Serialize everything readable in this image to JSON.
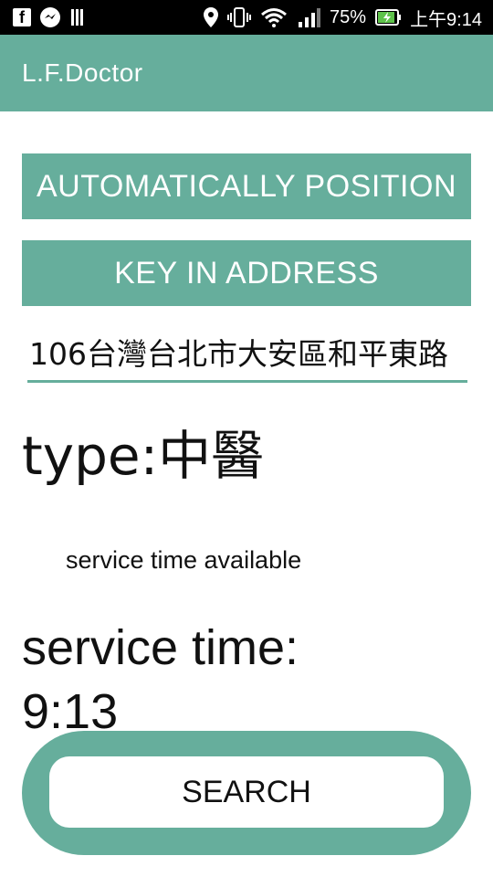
{
  "status_bar": {
    "battery": "75%",
    "time": "上午9:14",
    "icons": [
      "facebook-icon",
      "messenger-icon",
      "barcode-icon",
      "location-icon",
      "vibrate-icon",
      "wifi-icon",
      "signal-icon",
      "battery-charging-icon"
    ]
  },
  "app_bar": {
    "title": "L.F.Doctor"
  },
  "buttons": {
    "auto_position": "AUTOMATICALLY POSITION",
    "key_in_address": "KEY IN ADDRESS",
    "search": "SEARCH"
  },
  "address": {
    "value": "106台灣台北市大安區和平東路"
  },
  "type": {
    "label": "type:",
    "value": "中醫"
  },
  "service_status": "service time available",
  "service_time": {
    "label": "service time:",
    "value": "9:13"
  },
  "colors": {
    "accent": "#66ae9c",
    "status_bar": "#000000",
    "text": "#111111"
  }
}
